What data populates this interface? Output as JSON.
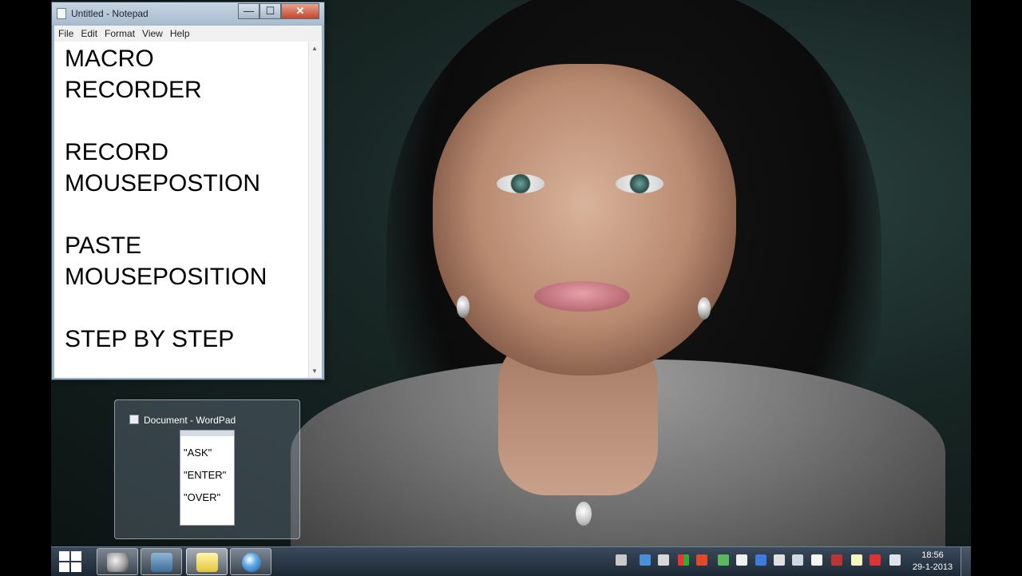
{
  "notepad": {
    "title": "Untitled - Notepad",
    "menu": [
      "File",
      "Edit",
      "Format",
      "View",
      "Help"
    ],
    "content_lines": [
      "MACRO",
      "RECORDER",
      "",
      "RECORD",
      "MOUSEPOSTION",
      "",
      "PASTE",
      "MOUSEPOSITION",
      "",
      "STEP BY STEP"
    ],
    "buttons": {
      "minimize": "—",
      "maximize": "☐",
      "close": "✕"
    }
  },
  "wordpad_preview": {
    "title": "Document - WordPad",
    "lines": [
      "\"ASK\"",
      "\"ENTER\"",
      "\"OVER\""
    ]
  },
  "taskbar": {
    "apps": [
      {
        "name": "app-1",
        "icon": "masks-icon"
      },
      {
        "name": "app-2",
        "icon": "windows-explorer-icon"
      },
      {
        "name": "app-3",
        "icon": "notepad-wordpad-icon",
        "state": "hover"
      },
      {
        "name": "app-4",
        "icon": "globe-icon",
        "state": "active"
      }
    ],
    "clock": {
      "time": "18:56",
      "date": "29-1-2013"
    }
  }
}
